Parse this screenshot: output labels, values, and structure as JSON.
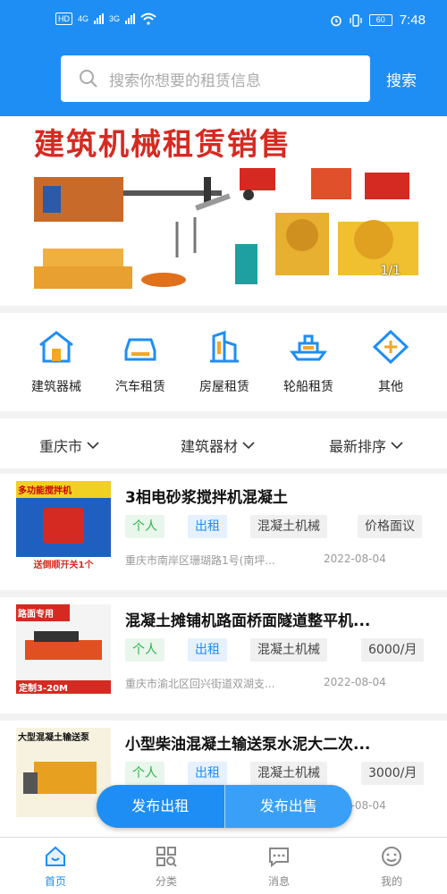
{
  "status_bar": {
    "network_left": "HD",
    "sig1": "4G",
    "sig2": "3G",
    "battery": "60",
    "time": "7:48"
  },
  "search": {
    "placeholder": "搜索你想要的租赁信息",
    "button": "搜索"
  },
  "banner": {
    "title": "建筑机械租赁销售",
    "counter": "1/1"
  },
  "categories": [
    {
      "label": "建筑器械",
      "icon": "house-icon"
    },
    {
      "label": "汽车租赁",
      "icon": "car-icon"
    },
    {
      "label": "房屋租赁",
      "icon": "building-icon"
    },
    {
      "label": "轮船租赁",
      "icon": "ship-icon"
    },
    {
      "label": "其他",
      "icon": "plus-diamond-icon"
    }
  ],
  "filters": {
    "city": "重庆市",
    "category": "建筑器材",
    "sort": "最新排序"
  },
  "listings": [
    {
      "title": "3相电砂浆搅拌机混凝土",
      "tags": [
        "个人",
        "出租",
        "混凝土机械",
        "价格面议"
      ],
      "address": "重庆市南岸区珊瑚路1号(南坪...",
      "date": "2022-08-04",
      "thumb_text": "多功能搅拌机",
      "thumb_sub": "送倒顺开关1个"
    },
    {
      "title": "混凝土摊铺机路面桥面隧道整平机...",
      "tags": [
        "个人",
        "出租",
        "混凝土机械",
        "6000/月"
      ],
      "address": "重庆市渝北区回兴街道双湖支...",
      "date": "2022-08-04",
      "thumb_text": "路面专用",
      "thumb_sub": "定制3-20M"
    },
    {
      "title": "小型柴油混凝土输送泵水泥大二次...",
      "tags": [
        "个人",
        "出租",
        "混凝土机械",
        "3000/月"
      ],
      "address": "",
      "date": "2022-08-04",
      "thumb_text": "大型混凝土输送泵",
      "thumb_sub": ""
    }
  ],
  "publish": {
    "rent": "发布出租",
    "sale": "发布出售"
  },
  "tabbar": [
    {
      "label": "首页",
      "icon": "home-icon",
      "active": true
    },
    {
      "label": "分类",
      "icon": "grid-search-icon",
      "active": false
    },
    {
      "label": "消息",
      "icon": "chat-icon",
      "active": false
    },
    {
      "label": "我的",
      "icon": "smile-icon",
      "active": false
    }
  ],
  "colors": {
    "primary": "#1e8ef4",
    "banner_red": "#d52a22",
    "tag_green": "#2fb34a"
  }
}
